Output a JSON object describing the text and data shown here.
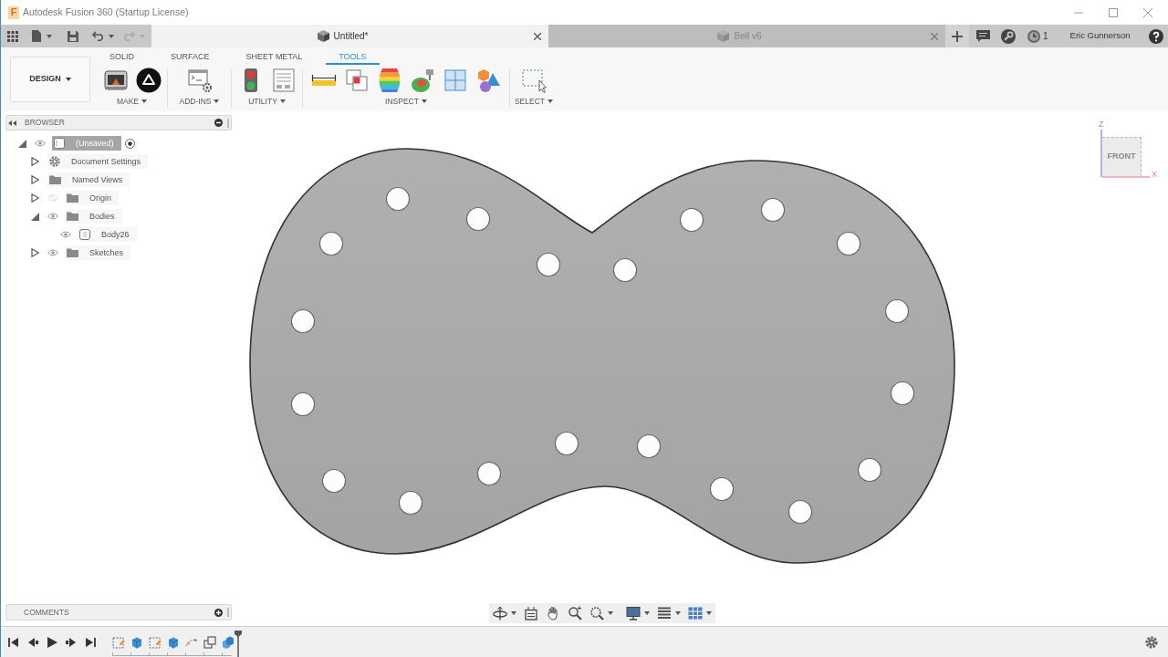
{
  "window": {
    "logo": "F",
    "title": "Autodesk Fusion 360 (Startup License)"
  },
  "history": {
    "can_undo": true,
    "can_redo": false
  },
  "document_tabs": [
    {
      "label": "Untitled*",
      "selected": true
    },
    {
      "label": "Bell v6",
      "selected": false
    }
  ],
  "header": {
    "job_count": "1",
    "user": "Eric Gunnerson"
  },
  "toolbar": {
    "workspace": "DESIGN",
    "tabs": [
      {
        "label": "SOLID",
        "selected": false
      },
      {
        "label": "SURFACE",
        "selected": false
      },
      {
        "label": "SHEET METAL",
        "selected": false
      },
      {
        "label": "TOOLS",
        "selected": true
      }
    ],
    "groups": [
      "MAKE",
      "ADD-INS",
      "UTILITY",
      "INSPECT",
      "SELECT"
    ]
  },
  "browser": {
    "title": "BROWSER",
    "items": [
      {
        "label": "(Unsaved)",
        "kind": "component",
        "visible": true,
        "expanded": true,
        "selected": true,
        "active": true,
        "children": [
          {
            "label": "Document Settings",
            "kind": "settings",
            "expanded": false,
            "selected": false
          },
          {
            "label": "Named Views",
            "kind": "folder",
            "expanded": false,
            "selected": false
          },
          {
            "label": "Origin",
            "kind": "folder",
            "visible": false,
            "expanded": false,
            "selected": false
          },
          {
            "label": "Bodies",
            "kind": "folder",
            "visible": true,
            "expanded": true,
            "selected": false,
            "children": [
              {
                "label": "Body26",
                "kind": "body",
                "visible": true,
                "selected": false
              }
            ]
          },
          {
            "label": "Sketches",
            "kind": "folder",
            "visible": true,
            "expanded": false,
            "selected": false
          }
        ]
      }
    ]
  },
  "view_cube": {
    "face": "FRONT",
    "axes": {
      "vertical": "Z",
      "horizontal": "X"
    }
  },
  "comments": {
    "title": "COMMENTS"
  }
}
